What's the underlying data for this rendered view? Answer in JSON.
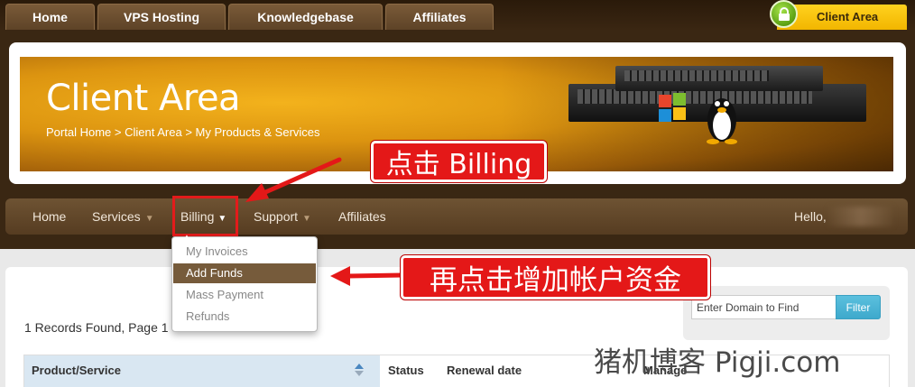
{
  "top_tabs": [
    "Home",
    "VPS Hosting",
    "Knowledgebase",
    "Affiliates"
  ],
  "client_area_tab": "Client Area",
  "banner": {
    "title": "Client Area",
    "breadcrumb": [
      "Portal Home",
      "Client Area",
      "My Products & Services"
    ],
    "breadcrumb_separator": ">"
  },
  "nav": {
    "home": "Home",
    "services": "Services",
    "billing": "Billing",
    "support": "Support",
    "affiliates": "Affiliates",
    "hello": "Hello,"
  },
  "billing_menu": {
    "items": [
      "My Invoices",
      "Add Funds",
      "Mass Payment",
      "Refunds"
    ],
    "active": "Add Funds"
  },
  "content": {
    "records_text": "1 Records Found, Page 1",
    "search_placeholder": "Enter Domain to Find",
    "filter_label": "Filter"
  },
  "table": {
    "columns": [
      "Product/Service",
      "Status",
      "Renewal date",
      "Manage"
    ]
  },
  "annotations": {
    "click_billing": "点击 Billing",
    "click_add_funds": "再点击增加帐户资金"
  },
  "watermark": "猪机博客 Pigji.com",
  "colors": {
    "annotation_red": "#e41818",
    "nav_brown": "#6e5333",
    "active_item": "#765b3b",
    "filter_blue": "#5bc0de",
    "client_tab_yellow": "#ffd11e"
  },
  "icons": [
    "lock-icon",
    "caret-down-icon",
    "sort-icon",
    "arrow-icon"
  ]
}
